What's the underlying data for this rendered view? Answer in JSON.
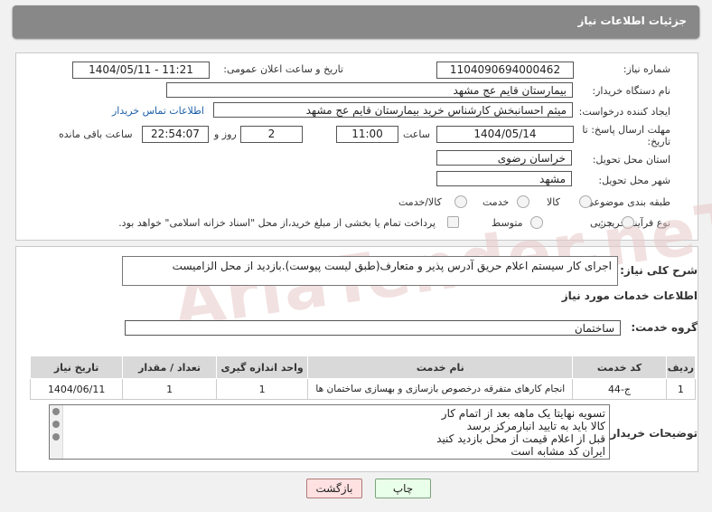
{
  "header": {
    "title": "جزئیات اطلاعات نیاز"
  },
  "watermark": "AriaTender.neT",
  "form": {
    "need_number_label": "شماره نیاز:",
    "need_number": "1104090694000462",
    "announce_label": "تاریخ و ساعت اعلان عمومی:",
    "announce_value": "1404/05/11 - 11:21",
    "buyer_label": "نام دستگاه خریدار:",
    "buyer_value": "بیمارستان قایم  عج  مشهد",
    "creator_label": "ایجاد کننده درخواست:",
    "creator_value": "میثم احسانبخش کارشناس خرید بیمارستان قایم  عج  مشهد",
    "contact_link": "اطلاعات تماس خریدار",
    "deadline_label": "مهلت ارسال پاسخ: تا تاریخ:",
    "deadline_date": "1404/05/14",
    "time_label": "ساعت",
    "deadline_time": "11:00",
    "days_value": "2",
    "days_label": "روز و",
    "remaining_time": "22:54:07",
    "remaining_label": "ساعت باقی مانده",
    "province_label": "استان محل تحویل:",
    "province_value": "خراسان رضوی",
    "city_label": "شهر محل تحویل:",
    "city_value": "مشهد",
    "category_label": "طبقه بندی موضوعی:",
    "category_options": [
      "کالا",
      "خدمت",
      "کالا/خدمت"
    ],
    "process_label": "نوع فرآیند خرید :",
    "process_options": [
      "جزیی",
      "متوسط"
    ],
    "payment_note": "پرداخت تمام یا بخشی از مبلغ خرید،از محل \"اسناد خزانه اسلامی\" خواهد بود."
  },
  "summary": {
    "label": "شرح کلی نیاز:",
    "value": "اجرای کار سیستم اعلام حریق آدرس پذیر و متعارف(طبق لیست پیوست).بازدید از محل الزامیست"
  },
  "services": {
    "title": "اطلاعات خدمات مورد نیاز",
    "group_label": "گروه خدمت:",
    "group_value": "ساختمان",
    "table": {
      "headers": [
        "ردیف",
        "کد خدمت",
        "نام خدمت",
        "واحد اندازه گیری",
        "تعداد / مقدار",
        "تاریخ نیاز"
      ],
      "rows": [
        [
          "1",
          "ج-44",
          "انجام کارهای متفرقه درخصوص بازسازی و بهسازی ساختمان ها",
          "1",
          "1",
          "1404/06/11"
        ]
      ]
    }
  },
  "notes": {
    "label": "توضیحات خریدار:",
    "lines": [
      "تسویه نهایتا یک ماهه بعد از اتمام کار",
      "کالا باید به تایید انبارمرکز برسد",
      "قبل از اعلام قیمت از محل بازدید کنید",
      "ایران کد مشابه است"
    ]
  },
  "buttons": {
    "print": "چاپ",
    "back": "بازگشت"
  }
}
